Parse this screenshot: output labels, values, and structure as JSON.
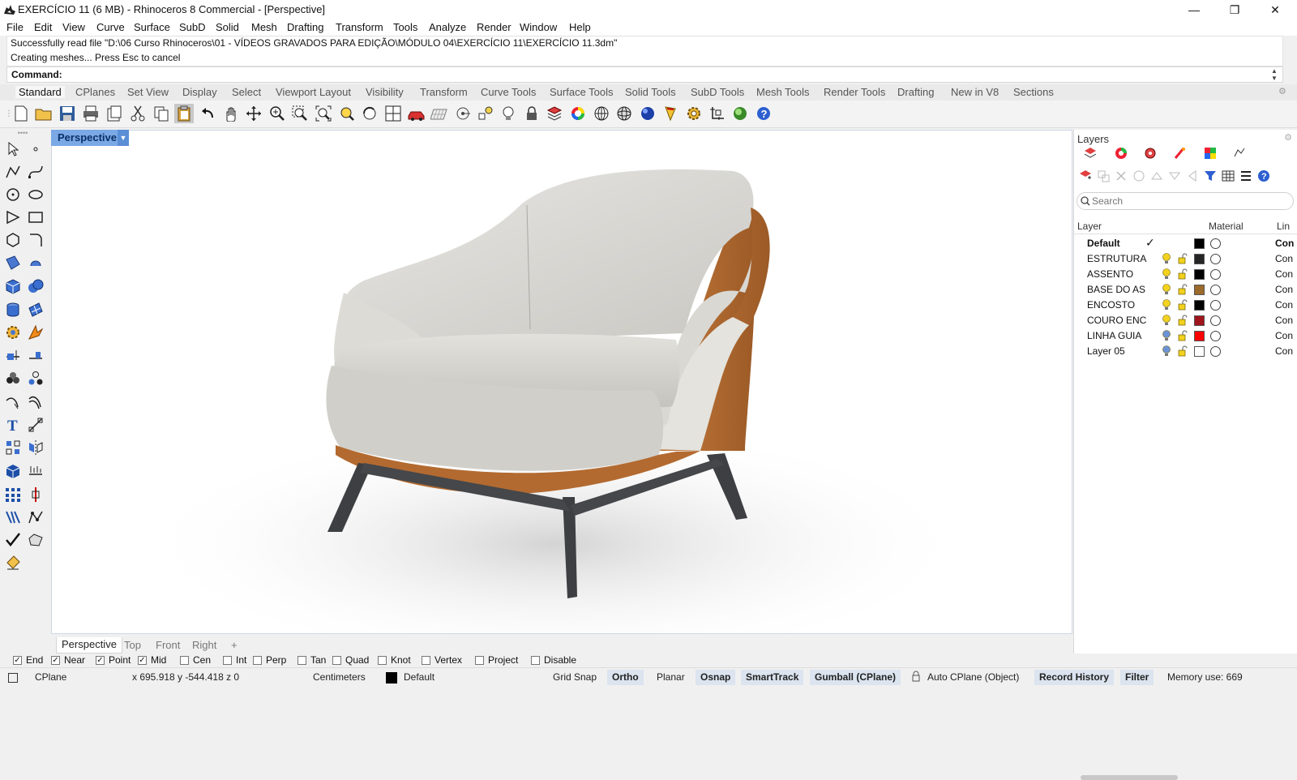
{
  "window": {
    "title": "EXERCÍCIO 11 (6 MB) - Rhinoceros 8 Commercial - [Perspective]",
    "minimize": "—",
    "restore": "❐",
    "close": "✕"
  },
  "menu": [
    "File",
    "Edit",
    "View",
    "Curve",
    "Surface",
    "SubD",
    "Solid",
    "Mesh",
    "Drafting",
    "Transform",
    "Tools",
    "Analyze",
    "Render",
    "Window",
    "Help"
  ],
  "command": {
    "history": [
      "Successfully read file \"D:\\06 Curso Rhinoceros\\01 - VÍDEOS GRAVADOS PARA EDIÇÃO\\MÓDULO 04\\EXERCÍCIO 11\\EXERCÍCIO 11.3dm\"",
      "Creating meshes... Press Esc to cancel"
    ],
    "prompt": "Command:"
  },
  "toolbar_tabs": [
    "Standard",
    "CPlanes",
    "Set View",
    "Display",
    "Select",
    "Viewport Layout",
    "Visibility",
    "Transform",
    "Curve Tools",
    "Surface Tools",
    "Solid Tools",
    "SubD Tools",
    "Mesh Tools",
    "Render Tools",
    "Drafting",
    "New in V8",
    "Sections"
  ],
  "viewport": {
    "active_name": "Perspective",
    "tabs": [
      "Perspective",
      "Top",
      "Front",
      "Right"
    ],
    "add_tab": "+"
  },
  "layers_panel": {
    "title": "Layers",
    "search_placeholder": "Search",
    "columns": {
      "layer": "Layer",
      "material": "Material",
      "linetype": "Lin"
    },
    "rows": [
      {
        "name": "Default",
        "color": "#000000",
        "linetype": "Con",
        "current": true
      },
      {
        "name": "ESTRUTURA",
        "color": "#262626",
        "linetype": "Con",
        "current": false
      },
      {
        "name": "ASSENTO",
        "color": "#000000",
        "linetype": "Con",
        "current": false
      },
      {
        "name": "BASE DO AS",
        "color": "#9c6a2a",
        "linetype": "Con",
        "current": false
      },
      {
        "name": "ENCOSTO",
        "color": "#000000",
        "linetype": "Con",
        "current": false
      },
      {
        "name": "COURO ENC",
        "color": "#a0141c",
        "linetype": "Con",
        "current": false
      },
      {
        "name": "LINHA GUIA",
        "color": "#ff0000",
        "linetype": "Con",
        "current": false
      },
      {
        "name": "Layer 05",
        "color": "#ffffff",
        "linetype": "Con",
        "current": false
      }
    ]
  },
  "osnap": [
    {
      "label": "End",
      "checked": true
    },
    {
      "label": "Near",
      "checked": true
    },
    {
      "label": "Point",
      "checked": true
    },
    {
      "label": "Mid",
      "checked": true
    },
    {
      "label": "Cen",
      "checked": false
    },
    {
      "label": "Int",
      "checked": false
    },
    {
      "label": "Perp",
      "checked": false
    },
    {
      "label": "Tan",
      "checked": false
    },
    {
      "label": "Quad",
      "checked": false
    },
    {
      "label": "Knot",
      "checked": false
    },
    {
      "label": "Vertex",
      "checked": false
    },
    {
      "label": "Project",
      "checked": false
    },
    {
      "label": "Disable",
      "checked": false
    }
  ],
  "status": {
    "cplane": "CPlane",
    "coords": "x 695.918   y -544.418   z 0",
    "units": "Centimeters",
    "layer": "Default",
    "grid_snap": "Grid Snap",
    "ortho": "Ortho",
    "planar": "Planar",
    "osnap": "Osnap",
    "smarttrack": "SmartTrack",
    "gumball": "Gumball (CPlane)",
    "auto_cplane": "Auto CPlane (Object)",
    "record_history": "Record History",
    "filter": "Filter",
    "memory": "Memory use: 669"
  },
  "colors": {
    "chair_fabric": "#d6d4cf",
    "chair_leather": "#b56a34",
    "chair_legs": "#3c3e40",
    "viewport_tab": "#7aa9e6"
  }
}
